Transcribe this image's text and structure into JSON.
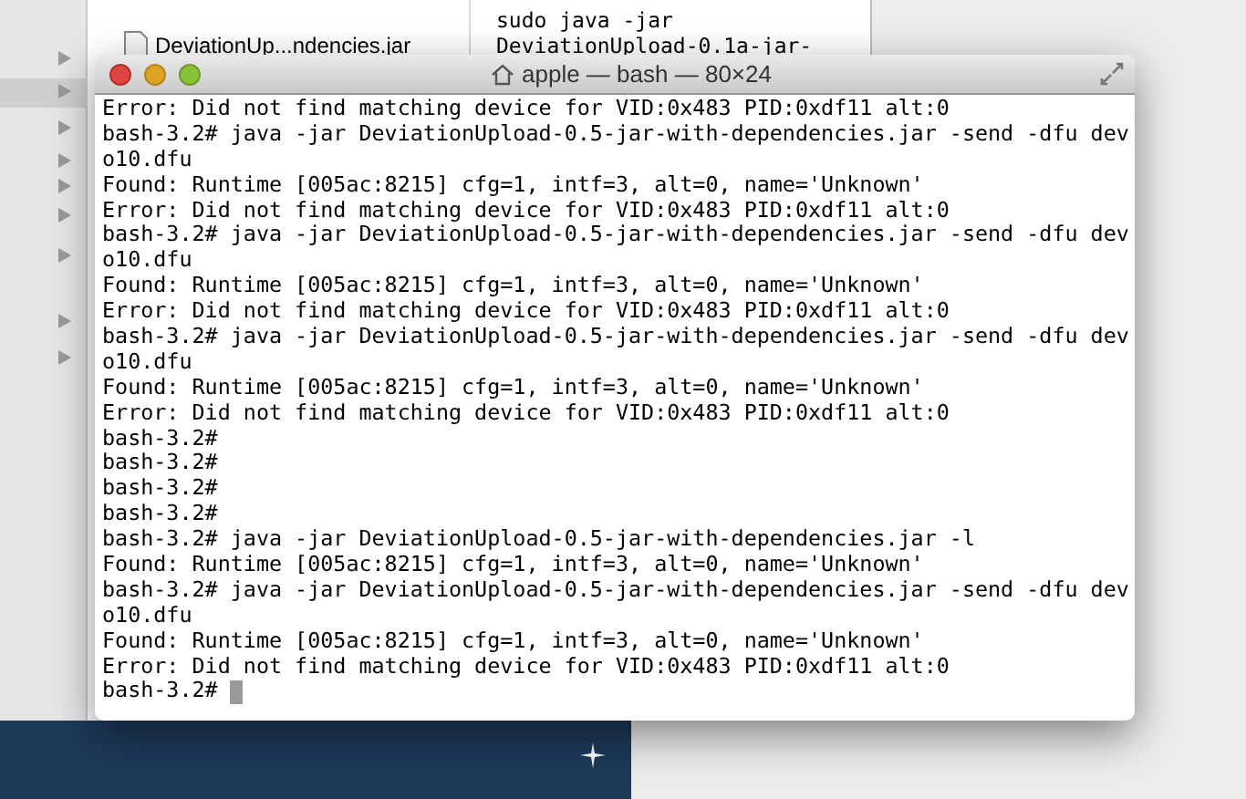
{
  "background_window": {
    "file_name": "DeviationUp...ndencies.jar",
    "preview_lines": [
      "sudo java -jar",
      "DeviationUpload-0.1a-jar-"
    ]
  },
  "terminal": {
    "title": "apple — bash — 80×24",
    "cursor": true,
    "lines": [
      "Error: Did not find matching device for VID:0x483 PID:0xdf11 alt:0",
      "bash-3.2# java -jar DeviationUpload-0.5-jar-with-dependencies.jar -send -dfu dev",
      "o10.dfu",
      "Found: Runtime [005ac:8215] cfg=1, intf=3, alt=0, name='Unknown'",
      "Error: Did not find matching device for VID:0x483 PID:0xdf11 alt:0",
      "bash-3.2# java -jar DeviationUpload-0.5-jar-with-dependencies.jar -send -dfu dev",
      "o10.dfu",
      "Found: Runtime [005ac:8215] cfg=1, intf=3, alt=0, name='Unknown'",
      "Error: Did not find matching device for VID:0x483 PID:0xdf11 alt:0",
      "bash-3.2# java -jar DeviationUpload-0.5-jar-with-dependencies.jar -send -dfu dev",
      "o10.dfu",
      "Found: Runtime [005ac:8215] cfg=1, intf=3, alt=0, name='Unknown'",
      "Error: Did not find matching device for VID:0x483 PID:0xdf11 alt:0",
      "bash-3.2#",
      "bash-3.2#",
      "bash-3.2#",
      "bash-3.2#",
      "bash-3.2# java -jar DeviationUpload-0.5-jar-with-dependencies.jar -l",
      "Found: Runtime [005ac:8215] cfg=1, intf=3, alt=0, name='Unknown'",
      "bash-3.2# java -jar DeviationUpload-0.5-jar-with-dependencies.jar -send -dfu dev",
      "o10.dfu",
      "Found: Runtime [005ac:8215] cfg=1, intf=3, alt=0, name='Unknown'",
      "Error: Did not find matching device for VID:0x483 PID:0xdf11 alt:0",
      "bash-3.2# "
    ]
  }
}
